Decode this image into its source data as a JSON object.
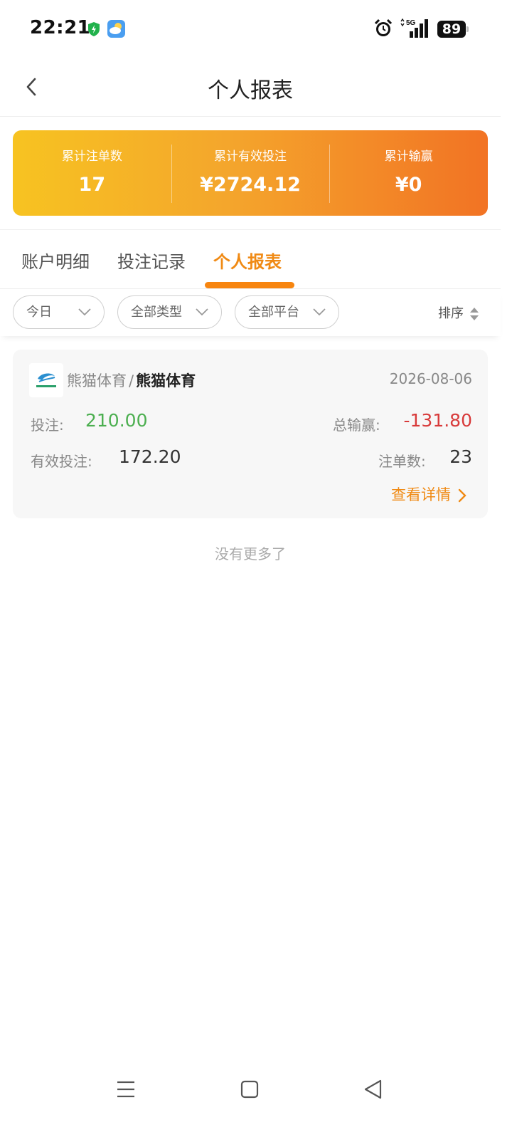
{
  "status_bar": {
    "time": "22:21",
    "network": "5G",
    "battery": "89",
    "icons": [
      "shield-icon",
      "weather-icon",
      "alarm-icon",
      "signal-icon",
      "battery-icon"
    ]
  },
  "header": {
    "title": "个人报表",
    "back_icon": "chevron-left-icon"
  },
  "summary": {
    "items": [
      {
        "label": "累计注单数",
        "value": "17"
      },
      {
        "label": "累计有效投注",
        "value": "¥2724.12"
      },
      {
        "label": "累计输赢",
        "value": "¥0"
      }
    ],
    "gradient_start": "#f7c321",
    "gradient_end": "#f27324"
  },
  "tabs": [
    {
      "label": "账户明细",
      "active": false
    },
    {
      "label": "投注记录",
      "active": false
    },
    {
      "label": "个人报表",
      "active": true
    }
  ],
  "filters": {
    "date": "今日",
    "type": "全部类型",
    "platform": "全部平台",
    "sort_label": "排序"
  },
  "records": [
    {
      "platform": "熊猫体育",
      "separator": "/",
      "sub_platform": "熊猫体育",
      "date": "2026-08-06",
      "bet_label": "投注:",
      "bet_value": "210.00",
      "win_label": "总输赢:",
      "win_value": "-131.80",
      "valid_label": "有效投注:",
      "valid_value": "172.20",
      "count_label": "注单数:",
      "count_value": "23",
      "detail_label": "查看详情"
    }
  ],
  "list_footer": "没有更多了",
  "colors": {
    "accent": "#f08a14",
    "positive": "#4caf50",
    "negative": "#d83a3a"
  }
}
